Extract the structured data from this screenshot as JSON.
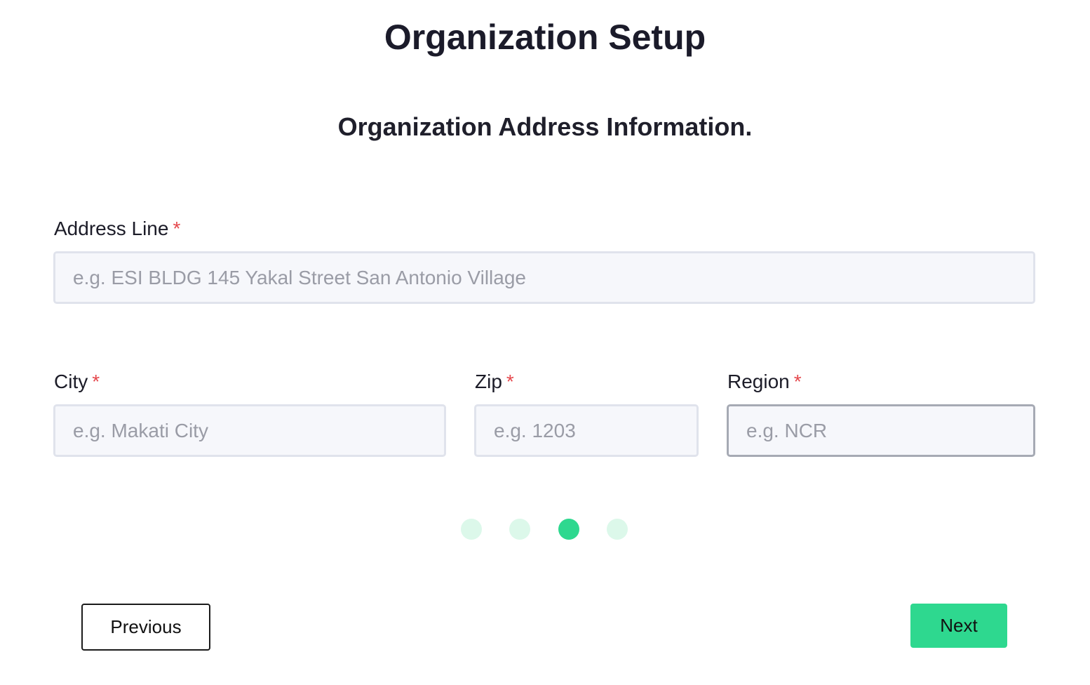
{
  "header": {
    "title": "Organization Setup",
    "subtitle": "Organization Address Information."
  },
  "form": {
    "required_marker": "*",
    "address_line": {
      "label": "Address Line",
      "value": "",
      "placeholder": "e.g. ESI BLDG 145 Yakal Street San Antonio Village"
    },
    "city": {
      "label": "City",
      "value": "",
      "placeholder": "e.g. Makati City"
    },
    "zip": {
      "label": "Zip",
      "value": "",
      "placeholder": "e.g. 1203"
    },
    "region": {
      "label": "Region",
      "value": "",
      "placeholder": "e.g. NCR"
    }
  },
  "stepper": {
    "total_steps": 4,
    "current_step": 3
  },
  "actions": {
    "previous_label": "Previous",
    "next_label": "Next"
  },
  "colors": {
    "accent": "#2ed88f",
    "accent_light": "#dcf8ea",
    "required": "#e5484d",
    "input_background": "#f6f7fb",
    "input_border": "#e0e3ec"
  }
}
